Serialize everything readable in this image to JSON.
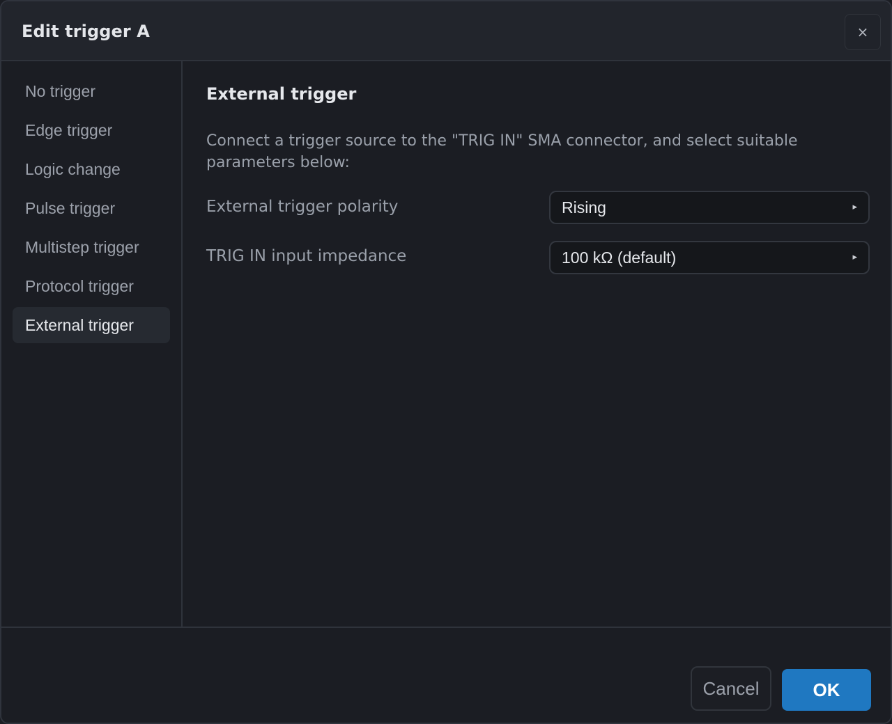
{
  "dialog": {
    "title": "Edit trigger A",
    "close_icon": "×"
  },
  "sidebar": {
    "items": [
      {
        "label": "No trigger",
        "active": false
      },
      {
        "label": "Edge trigger",
        "active": false
      },
      {
        "label": "Logic change",
        "active": false
      },
      {
        "label": "Pulse trigger",
        "active": false
      },
      {
        "label": "Multistep trigger",
        "active": false
      },
      {
        "label": "Protocol trigger",
        "active": false
      },
      {
        "label": "External trigger",
        "active": true
      }
    ]
  },
  "content": {
    "title": "External trigger",
    "description": "Connect a trigger source to the \"TRIG IN\" SMA connector, and select suitable parameters below:",
    "fields": [
      {
        "label": "External trigger polarity",
        "value": "Rising",
        "arrow": "▸"
      },
      {
        "label": "TRIG IN input impedance",
        "value": "100 kΩ (default)",
        "arrow": "▸"
      }
    ]
  },
  "footer": {
    "cancel_label": "Cancel",
    "ok_label": "OK"
  },
  "colors": {
    "accent": "#1f78c1",
    "background": "#1b1d23",
    "active_item": "#262a31"
  }
}
